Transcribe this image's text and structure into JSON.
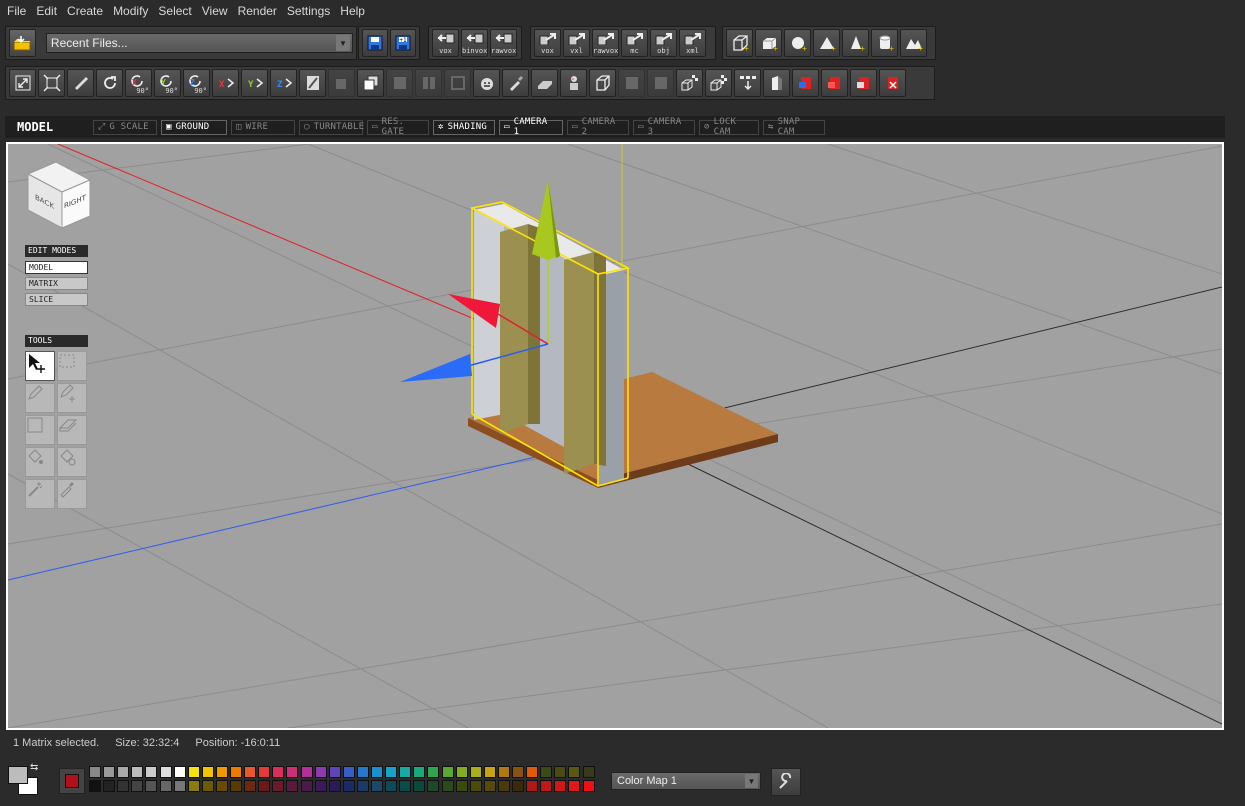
{
  "menu": [
    "File",
    "Edit",
    "Create",
    "Modify",
    "Select",
    "View",
    "Render",
    "Settings",
    "Help"
  ],
  "toolbar1": {
    "recent_files": "Recent Files...",
    "import_labels": [
      "vox",
      "binvox",
      "rawvox"
    ],
    "export_labels": [
      "vox",
      "vxl",
      "rawvox",
      "mc",
      "obj",
      "xml"
    ]
  },
  "toolbar2": {
    "rotate_labels": [
      "90°",
      "90°",
      "90°"
    ],
    "axis_x": "X",
    "axis_y": "Y",
    "axis_z": "Z"
  },
  "view_header": {
    "mode": "MODEL",
    "buttons": [
      {
        "label": "G SCALE",
        "icon": "⤢",
        "on": false
      },
      {
        "label": "GROUND",
        "icon": "▣",
        "on": true
      },
      {
        "label": "WIRE",
        "icon": "◫",
        "on": false
      },
      {
        "label": "TURNTABLE",
        "icon": "◯",
        "on": false
      },
      {
        "label": "RES. GATE",
        "icon": "▭",
        "on": false
      },
      {
        "label": "SHADING",
        "icon": "✲",
        "on": true
      },
      {
        "label": "CAMERA 1",
        "icon": "▭",
        "on": true
      },
      {
        "label": "CAMERA 2",
        "icon": "▭",
        "on": false
      },
      {
        "label": "CAMERA 3",
        "icon": "▭",
        "on": false
      },
      {
        "label": "LOCK CAM",
        "icon": "⊘",
        "on": false
      },
      {
        "label": "SNAP CAM",
        "icon": "⇆",
        "on": false
      }
    ]
  },
  "viewcube": {
    "back": "BACK",
    "right": "RIGHT"
  },
  "edit_modes": {
    "header": "EDIT MODES",
    "items": [
      "MODEL",
      "MATRIX",
      "SLICE"
    ],
    "active": "MODEL"
  },
  "tools": {
    "header": "TOOLS"
  },
  "status": {
    "selection": "1 Matrix selected.",
    "size": "Size: 32:32:4",
    "position": "Position: -16:0:11"
  },
  "colormap": {
    "label": "Color Map 1",
    "primary": "#b0101e",
    "fg": "#bcbcbc",
    "bg": "#ffffff"
  },
  "palette_row1": [
    "#888888",
    "#9a9a9a",
    "#aaaaaa",
    "#bbbbbb",
    "#cccccc",
    "#dddddd",
    "#ffffff",
    "#f5e20a",
    "#f4c300",
    "#f09a00",
    "#ee7a00",
    "#e8592b",
    "#e43a3a",
    "#dc2c5a",
    "#cc2f77",
    "#b52f9a",
    "#8e3aaf",
    "#5c45b8",
    "#3a5cc6",
    "#2577cf",
    "#1a8fd0",
    "#14a3c4",
    "#15aba4",
    "#1aa97b",
    "#2da64f",
    "#5aa82f",
    "#84ab22",
    "#a9ae1a",
    "#c8a412",
    "#b07a10",
    "#8a5210",
    "#e05a0a",
    "#3a4a1a",
    "#4a4a12",
    "#5a5812",
    "#3a3a1a"
  ],
  "palette_row2": [
    "#111111",
    "#222222",
    "#333333",
    "#444444",
    "#555555",
    "#666666",
    "#777777",
    "#8a7a10",
    "#6a5a00",
    "#6a4a00",
    "#5a3a00",
    "#6a2a10",
    "#6a1a1a",
    "#6a1a2a",
    "#5a1a3a",
    "#4a1a4a",
    "#3a1a5a",
    "#2a1a5a",
    "#1a2a6a",
    "#1a3a6a",
    "#1a4a6a",
    "#0a4a5a",
    "#0a4a4a",
    "#0a4a3a",
    "#1a4a2a",
    "#2a4a1a",
    "#3a4a0a",
    "#4a4a0a",
    "#5a4a0a",
    "#4a3a0a",
    "#3a2a0a",
    "#b01818",
    "#c01818",
    "#d01818",
    "#e01818",
    "#f01010"
  ]
}
